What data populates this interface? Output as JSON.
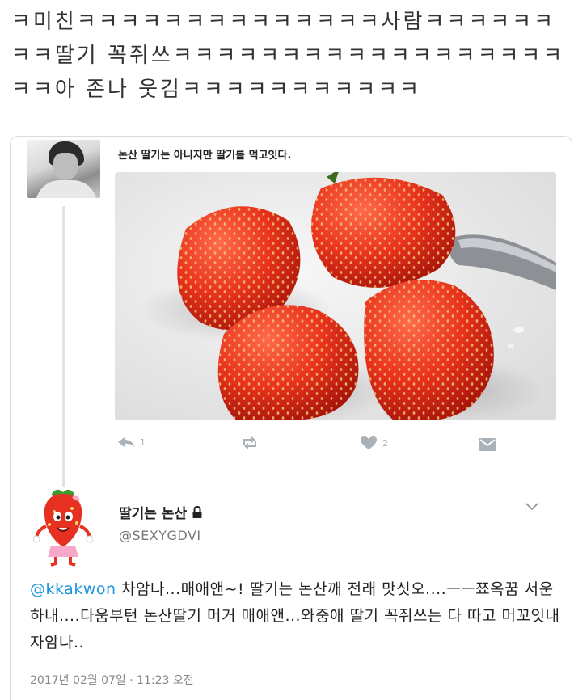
{
  "caption": "ㅋ미친ㅋㅋㅋㅋㅋㅋㅋㅋㅋㅋㅋㅋㅋㅋ사람ㅋㅋㅋㅋㅋㅋㅋㅋ딸기 꼭쥐쓰ㅋㅋㅋㅋㅋㅋㅋㅋㅋㅋㅋㅋㅋㅋㅋㅋㅋㅋㅋㅋ아 존나 웃김ㅋㅋㅋㅋㅋㅋㅋㅋㅋㅋㅋ",
  "quoted_tweet": {
    "text": "논산 딸기는 아니지만 딸기를 먹고잇다.",
    "reply_count": "1",
    "like_count": "2",
    "icons": [
      "reply-icon",
      "retweet-icon",
      "heart-icon",
      "direct-message-icon"
    ]
  },
  "reply": {
    "display_name": "딸기는 논산",
    "handle": "@SEXYGDVI",
    "mention": "@kkakwon",
    "body": " 차암나...매애앤~! 딸기는 논산깨 전래 맛싯오....ㅡㅡ쬬옥꿈 서운하내....다움부턴 논산딸기 머거 매애앤...와중애 딸기 꼭쥐쓰는 다 따고 머꼬잇내 자암나..",
    "timestamp": "2017년 02월 07일 · 11:23 오전",
    "icons": [
      "lock-icon",
      "chevron-down-icon"
    ]
  },
  "colors": {
    "mention": "#1b95e0",
    "action_gray": "#aab2b8",
    "strawberry_red": "#e8321e"
  }
}
